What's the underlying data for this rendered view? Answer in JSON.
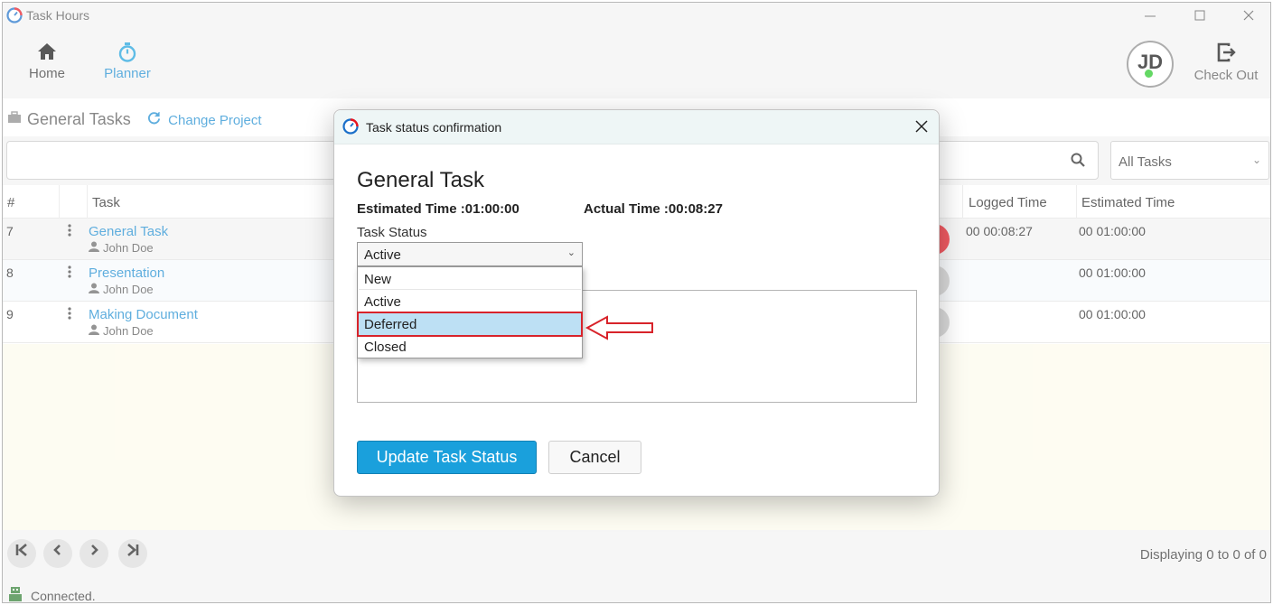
{
  "window": {
    "title": "Task Hours"
  },
  "toolbar": {
    "home_label": "Home",
    "planner_label": "Planner",
    "avatar_initials": "JD",
    "checkout_label": "Check Out"
  },
  "project": {
    "title": "General Tasks",
    "change_label": "Change Project"
  },
  "search": {
    "value": "",
    "filter_selected": "All Tasks"
  },
  "table": {
    "headers": {
      "num": "#",
      "task": "Task",
      "logged": "Logged Time",
      "estimated": "Estimated Time"
    },
    "rows": [
      {
        "num": "7",
        "task": "General Task",
        "owner": "John Doe",
        "logged": "00 00:08:27",
        "estimated": "00 01:00:00"
      },
      {
        "num": "8",
        "task": "Presentation",
        "owner": "John Doe",
        "logged": "",
        "estimated": "00 01:00:00"
      },
      {
        "num": "9",
        "task": "Making Document",
        "owner": "John Doe",
        "logged": "",
        "estimated": "00 01:00:00"
      }
    ]
  },
  "pager": {
    "displaying": "Displaying 0 to 0 of 0"
  },
  "status": {
    "connection": "Connected."
  },
  "modal": {
    "title": "Task status confirmation",
    "task_name": "General Task",
    "estimated": "Estimated Time :01:00:00",
    "actual": "Actual Time :00:08:27",
    "status_label": "Task Status",
    "status_selected": "Active",
    "options": [
      "New",
      "Active",
      "Deferred",
      "Closed"
    ],
    "update_label": "Update Task Status",
    "cancel_label": "Cancel"
  },
  "colors": {
    "accent": "#1aa0dc",
    "link": "#1a8bd0",
    "highlight": "#d8232a",
    "timer_active": "#e8141e"
  }
}
